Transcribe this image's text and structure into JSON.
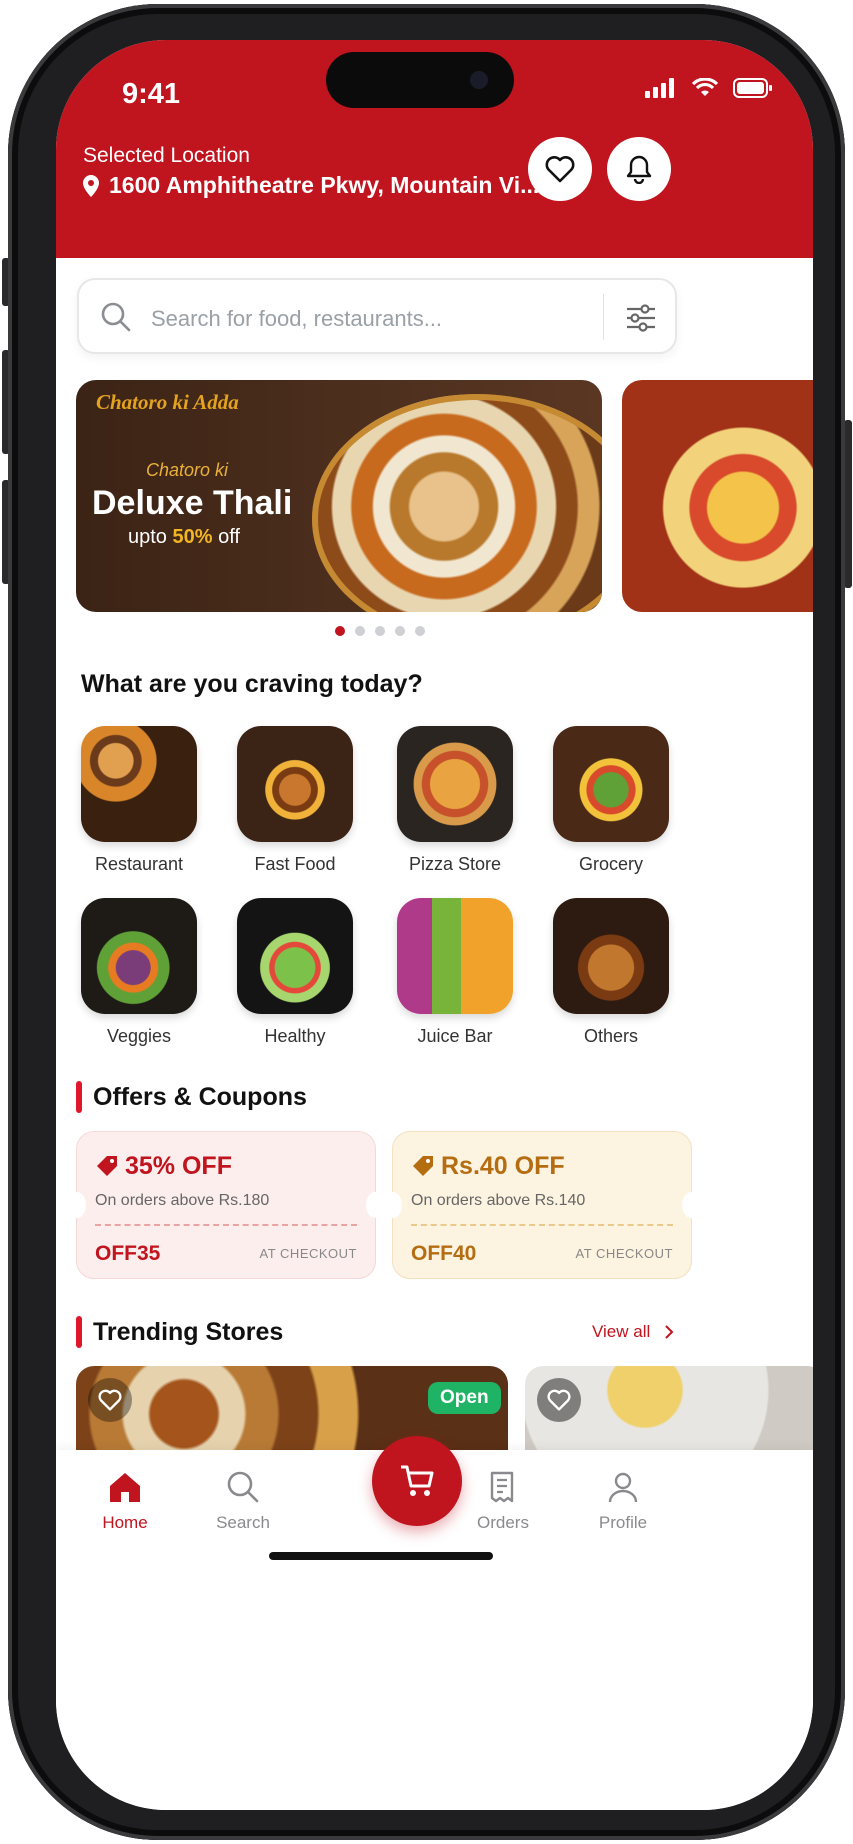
{
  "status": {
    "time": "9:41"
  },
  "location": {
    "label": "Selected Location",
    "address": "1600 Amphitheatre Pkwy, Mountain Vi..."
  },
  "search": {
    "placeholder": "Search for food, restaurants..."
  },
  "banner": {
    "brand": "Chatoro ki Adda",
    "subtitle": "Chatoro ki",
    "title": "Deluxe Thali",
    "offer_prefix": "upto",
    "offer_value": "50%",
    "offer_suffix": "off"
  },
  "carousel": {
    "count": 5,
    "active": 0
  },
  "craving": {
    "heading": "What are you craving today?",
    "categories": [
      {
        "label": "Restaurant"
      },
      {
        "label": "Fast Food"
      },
      {
        "label": "Pizza Store"
      },
      {
        "label": "Grocery"
      },
      {
        "label": "Veggies"
      },
      {
        "label": "Healthy"
      },
      {
        "label": "Juice Bar"
      },
      {
        "label": "Others"
      }
    ]
  },
  "offers": {
    "heading": "Offers & Coupons",
    "coupons": [
      {
        "title": "35% OFF",
        "desc": "On orders above Rs.180",
        "code": "OFF35",
        "note": "AT CHECKOUT",
        "color": "#c0141f",
        "bg": "#fdeeee"
      },
      {
        "title": "Rs.40 OFF",
        "desc": "On orders above Rs.140",
        "code": "OFF40",
        "note": "AT CHECKOUT",
        "color": "#b56d12",
        "bg": "#fdf3e1"
      }
    ]
  },
  "trending": {
    "heading": "Trending Stores",
    "view_all": "View all",
    "badge": "Open"
  },
  "nav": {
    "home": "Home",
    "search": "Search",
    "orders": "Orders",
    "profile": "Profile"
  },
  "colors": {
    "brand": "#c0141f",
    "open": "#1fb465"
  }
}
